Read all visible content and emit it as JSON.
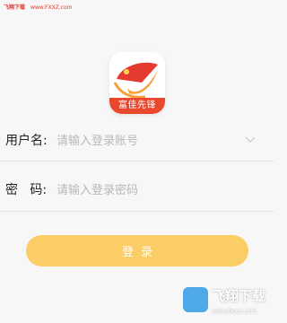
{
  "watermark_top": {
    "brand": "飞翔下载",
    "url": "www.FXXZ.com"
  },
  "logo": {
    "text": "富佳先锋",
    "icon": "party-flag-logo",
    "colors": {
      "red": "#e53a2f",
      "orange": "#f6a23a",
      "banner": "#e9482f"
    }
  },
  "form": {
    "username": {
      "label": "用户名:",
      "placeholder": "请输入登录账号",
      "value": "",
      "dropdown_icon": "chevron-down-icon"
    },
    "password": {
      "label": "密   码:",
      "placeholder": "请输入登录密码",
      "value": ""
    },
    "login_label": "登录"
  },
  "theme": {
    "button_color": "#fbcd66",
    "placeholder_color": "#b9b9b9",
    "background": "#f7f7f7"
  },
  "watermark_bottom": {
    "title": "飞翔下载",
    "url": "www.fxxz.com"
  }
}
